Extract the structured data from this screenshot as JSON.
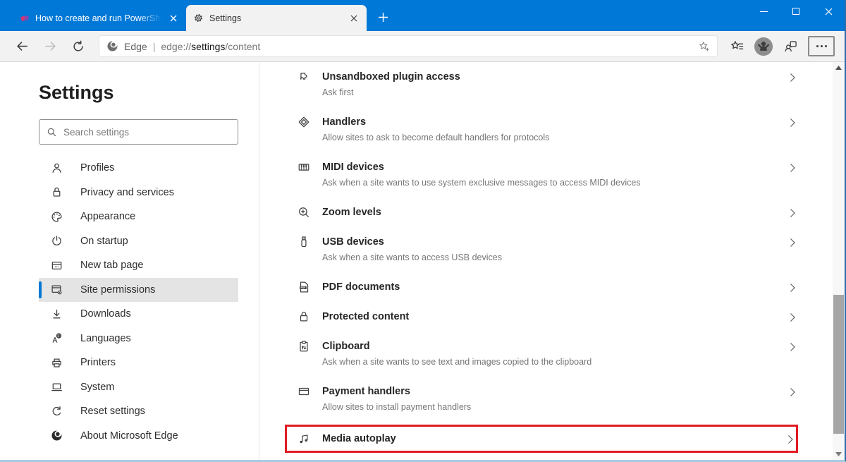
{
  "titlebar": {
    "tabs": [
      {
        "title": "How to create and run PowerShe",
        "active": false
      },
      {
        "title": "Settings",
        "active": true
      }
    ]
  },
  "toolbar": {
    "address": {
      "engine_label": "Edge",
      "divider": "|",
      "scheme": "edge://",
      "highlight": "settings",
      "path": "/content"
    }
  },
  "sidebar": {
    "title": "Settings",
    "search_placeholder": "Search settings",
    "items": [
      {
        "label": "Profiles"
      },
      {
        "label": "Privacy and services"
      },
      {
        "label": "Appearance"
      },
      {
        "label": "On startup"
      },
      {
        "label": "New tab page"
      },
      {
        "label": "Site permissions",
        "selected": true
      },
      {
        "label": "Downloads"
      },
      {
        "label": "Languages"
      },
      {
        "label": "Printers"
      },
      {
        "label": "System"
      },
      {
        "label": "Reset settings"
      },
      {
        "label": "About Microsoft Edge"
      }
    ]
  },
  "content": {
    "items": [
      {
        "title": "Unsandboxed plugin access",
        "desc": "Ask first"
      },
      {
        "title": "Handlers",
        "desc": "Allow sites to ask to become default handlers for protocols"
      },
      {
        "title": "MIDI devices",
        "desc": "Ask when a site wants to use system exclusive messages to access MIDI devices"
      },
      {
        "title": "Zoom levels"
      },
      {
        "title": "USB devices",
        "desc": "Ask when a site wants to access USB devices"
      },
      {
        "title": "PDF documents"
      },
      {
        "title": "Protected content"
      },
      {
        "title": "Clipboard",
        "desc": "Ask when a site wants to see text and images copied to the clipboard"
      },
      {
        "title": "Payment handlers",
        "desc": "Allow sites to install payment handlers"
      },
      {
        "title": "Media autoplay",
        "highlighted": true
      }
    ]
  },
  "icons": {
    "names": [
      "site-favicon",
      "gear-icon",
      "close-icon",
      "new-tab-icon",
      "minimize-icon",
      "maximize-icon",
      "back-icon",
      "forward-icon",
      "refresh-icon",
      "edge-logo-icon",
      "add-favorite-icon",
      "favorites-bar-icon",
      "avatar",
      "feedback-icon",
      "more-icon",
      "search-icon",
      "profile-icon",
      "lock-icon",
      "palette-icon",
      "power-icon",
      "new-tab-page-icon",
      "site-permissions-icon",
      "download-icon",
      "languages-icon",
      "printer-icon",
      "laptop-icon",
      "reset-icon",
      "edge-about-icon",
      "puzzle-icon",
      "handlers-icon",
      "midi-icon",
      "zoom-icon",
      "usb-icon",
      "pdf-icon",
      "protected-lock-icon",
      "clipboard-icon",
      "payment-icon",
      "media-autoplay-icon",
      "chevron-right-icon",
      "scroll-up-icon",
      "scroll-down-icon"
    ]
  },
  "colors": {
    "titlebar_blue": "#0078d7",
    "accent_blue": "#0078d4",
    "highlight_red": "#e21b22",
    "selected_gray": "#e4e4e4",
    "toolbar_gray": "#f2f2f2"
  }
}
